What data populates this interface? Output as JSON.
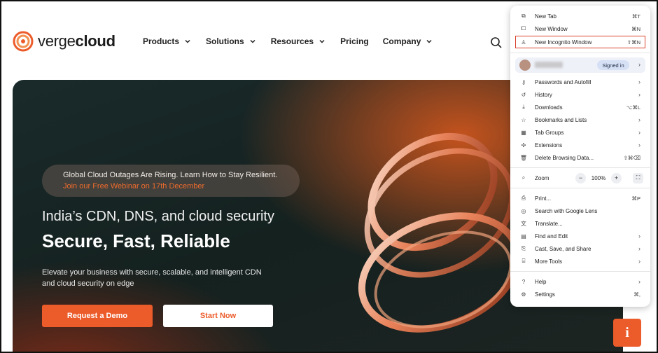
{
  "brand": {
    "name_light": "verge",
    "name_bold": "cloud"
  },
  "nav": [
    {
      "label": "Products",
      "has_dropdown": true
    },
    {
      "label": "Solutions",
      "has_dropdown": true
    },
    {
      "label": "Resources",
      "has_dropdown": true
    },
    {
      "label": "Pricing",
      "has_dropdown": false
    },
    {
      "label": "Company",
      "has_dropdown": true
    }
  ],
  "hero": {
    "promo_line1": "Global Cloud Outages Are Rising. Learn How to Stay Resilient.",
    "promo_line2": "Join our Free Webinar on 17th December",
    "subtitle": "India’s CDN, DNS, and cloud security",
    "title": "Secure, Fast, Reliable",
    "description": "Elevate your business with secure, scalable, and intelligent CDN and cloud security on edge",
    "btn_demo": "Request a Demo",
    "btn_start": "Start Now"
  },
  "chat_button": "i",
  "menu": {
    "new_tab": {
      "label": "New Tab",
      "shortcut": "⌘T"
    },
    "new_window": {
      "label": "New Window",
      "shortcut": "⌘N"
    },
    "new_incognito": {
      "label": "New Incognito Window",
      "shortcut": "⇧⌘N"
    },
    "signed_in": "Signed in",
    "passwords": {
      "label": "Passwords and Autofill"
    },
    "history": {
      "label": "History"
    },
    "downloads": {
      "label": "Downloads",
      "shortcut": "⌥⌘L"
    },
    "bookmarks": {
      "label": "Bookmarks and Lists"
    },
    "tab_groups": {
      "label": "Tab Groups"
    },
    "extensions": {
      "label": "Extensions"
    },
    "delete_data": {
      "label": "Delete Browsing Data...",
      "shortcut": "⇧⌘⌫"
    },
    "zoom": {
      "label": "Zoom",
      "minus": "−",
      "value": "100%",
      "plus": "+"
    },
    "print": {
      "label": "Print...",
      "shortcut": "⌘P"
    },
    "google_lens": {
      "label": "Search with Google Lens"
    },
    "translate": {
      "label": "Translate..."
    },
    "find_edit": {
      "label": "Find and Edit"
    },
    "cast_save": {
      "label": "Cast, Save, and Share"
    },
    "more_tools": {
      "label": "More Tools"
    },
    "help": {
      "label": "Help"
    },
    "settings": {
      "label": "Settings",
      "shortcut": "⌘,"
    }
  },
  "colors": {
    "accent": "#ec5b2a",
    "highlight_border": "#d9452f"
  }
}
